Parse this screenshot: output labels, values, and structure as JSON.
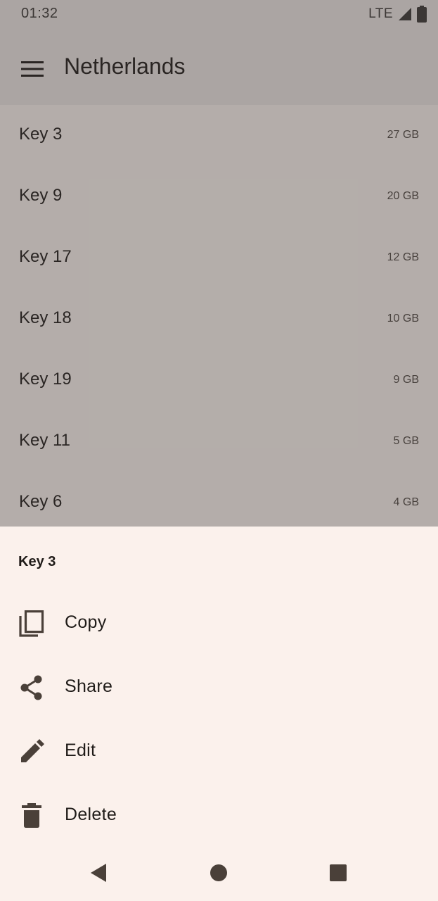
{
  "status_bar": {
    "time": "01:32",
    "network": "LTE",
    "signal_icon": "signal-icon",
    "battery_icon": "battery-icon"
  },
  "app_bar": {
    "menu_icon": "menu-icon",
    "title": "Netherlands"
  },
  "list": {
    "items": [
      {
        "label": "Key 3",
        "size": "27 GB"
      },
      {
        "label": "Key 9",
        "size": "20 GB"
      },
      {
        "label": "Key 17",
        "size": "12 GB"
      },
      {
        "label": "Key 18",
        "size": "10 GB"
      },
      {
        "label": "Key 19",
        "size": "9 GB"
      },
      {
        "label": "Key 11",
        "size": "5 GB"
      },
      {
        "label": "Key 6",
        "size": "4 GB"
      }
    ]
  },
  "sheet": {
    "title": "Key 3",
    "actions": [
      {
        "label": "Copy",
        "icon": "copy-icon"
      },
      {
        "label": "Share",
        "icon": "share-icon"
      },
      {
        "label": "Edit",
        "icon": "edit-icon"
      },
      {
        "label": "Delete",
        "icon": "delete-icon"
      }
    ]
  },
  "nav_bar": {
    "back_icon": "back-icon",
    "home_icon": "home-icon",
    "recents_icon": "recents-icon"
  },
  "colors": {
    "scrim": "#3c3836",
    "sheet_background": "#fbf1ec",
    "icon": "#4a4039",
    "text": "#1f1b18"
  }
}
